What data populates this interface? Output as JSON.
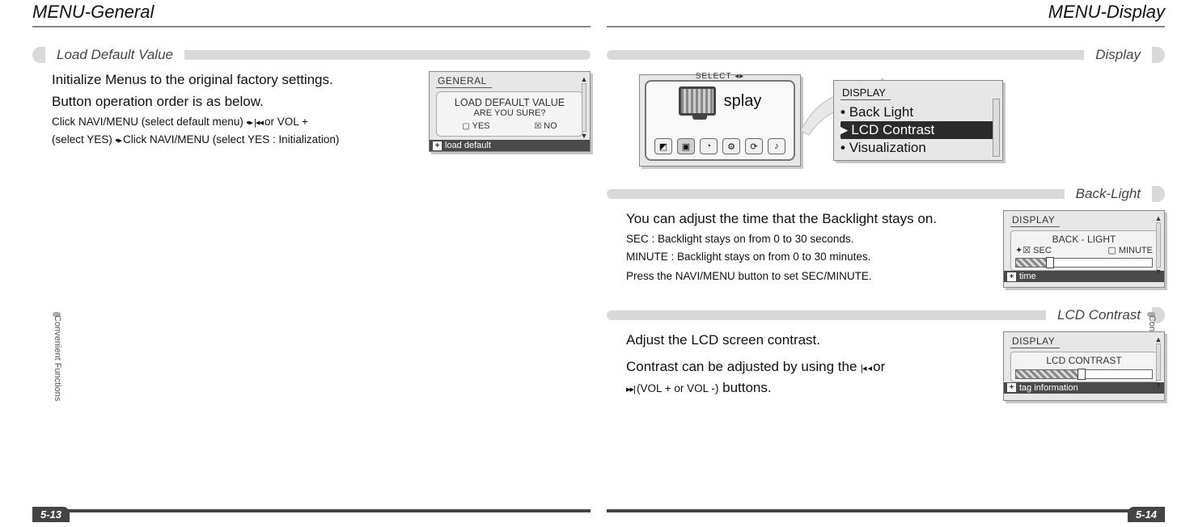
{
  "leftPage": {
    "title": "MENU-General",
    "sideTab": "Convenient Functions",
    "pageNum": "5-13",
    "section1": {
      "heading": "Load Default Value",
      "line1": "Initialize Menus to the original factory settings.",
      "line2": "Button operation order is as below.",
      "line3a": "Click NAVI/MENU (select default menu)",
      "line3b": "or VOL +",
      "line4a": "(select YES)",
      "line4b": "Click NAVI/MENU (select YES : Initialization)",
      "lcd": {
        "tab": "GENERAL",
        "big": "LOAD DEFAULT VALUE",
        "sub": "ARE YOU SURE?",
        "yes": "YES",
        "no": "NO",
        "footer": "load default"
      }
    }
  },
  "rightPage": {
    "title": "MENU-Display",
    "sideTab": "Convenient Functions",
    "pageNum": "5-14",
    "secDisplay": {
      "heading": "Display",
      "selectLabel": "SELECT ◂▸",
      "cardLabel": "splay",
      "listTab": "DISPLAY",
      "items": [
        "Back Light",
        "LCD Contrast",
        "Visualization"
      ],
      "selectedIndex": 1
    },
    "secBacklight": {
      "heading": "Back-Light",
      "line1": "You can adjust the time that the Backlight stays on.",
      "line2": "SEC : Backlight stays on from 0 to 30 seconds.",
      "line3": "MINUTE : Backlight stays on from 0 to 30 minutes.",
      "line4": "Press the NAVI/MENU button to set SEC/MINUTE.",
      "lcd": {
        "tab": "DISPLAY",
        "title": "BACK - LIGHT",
        "opt1": "SEC",
        "opt2": "MINUTE",
        "footer": "time"
      }
    },
    "secContrast": {
      "heading": "LCD Contrast",
      "line1": "Adjust the LCD screen contrast.",
      "line2a": "Contrast can be adjusted by using the",
      "line2b": "or",
      "line3a": "(VOL + or VOL -)",
      "line3b": "buttons.",
      "lcd": {
        "tab": "DISPLAY",
        "title": "LCD CONTRAST",
        "footer": "tag information"
      }
    }
  }
}
